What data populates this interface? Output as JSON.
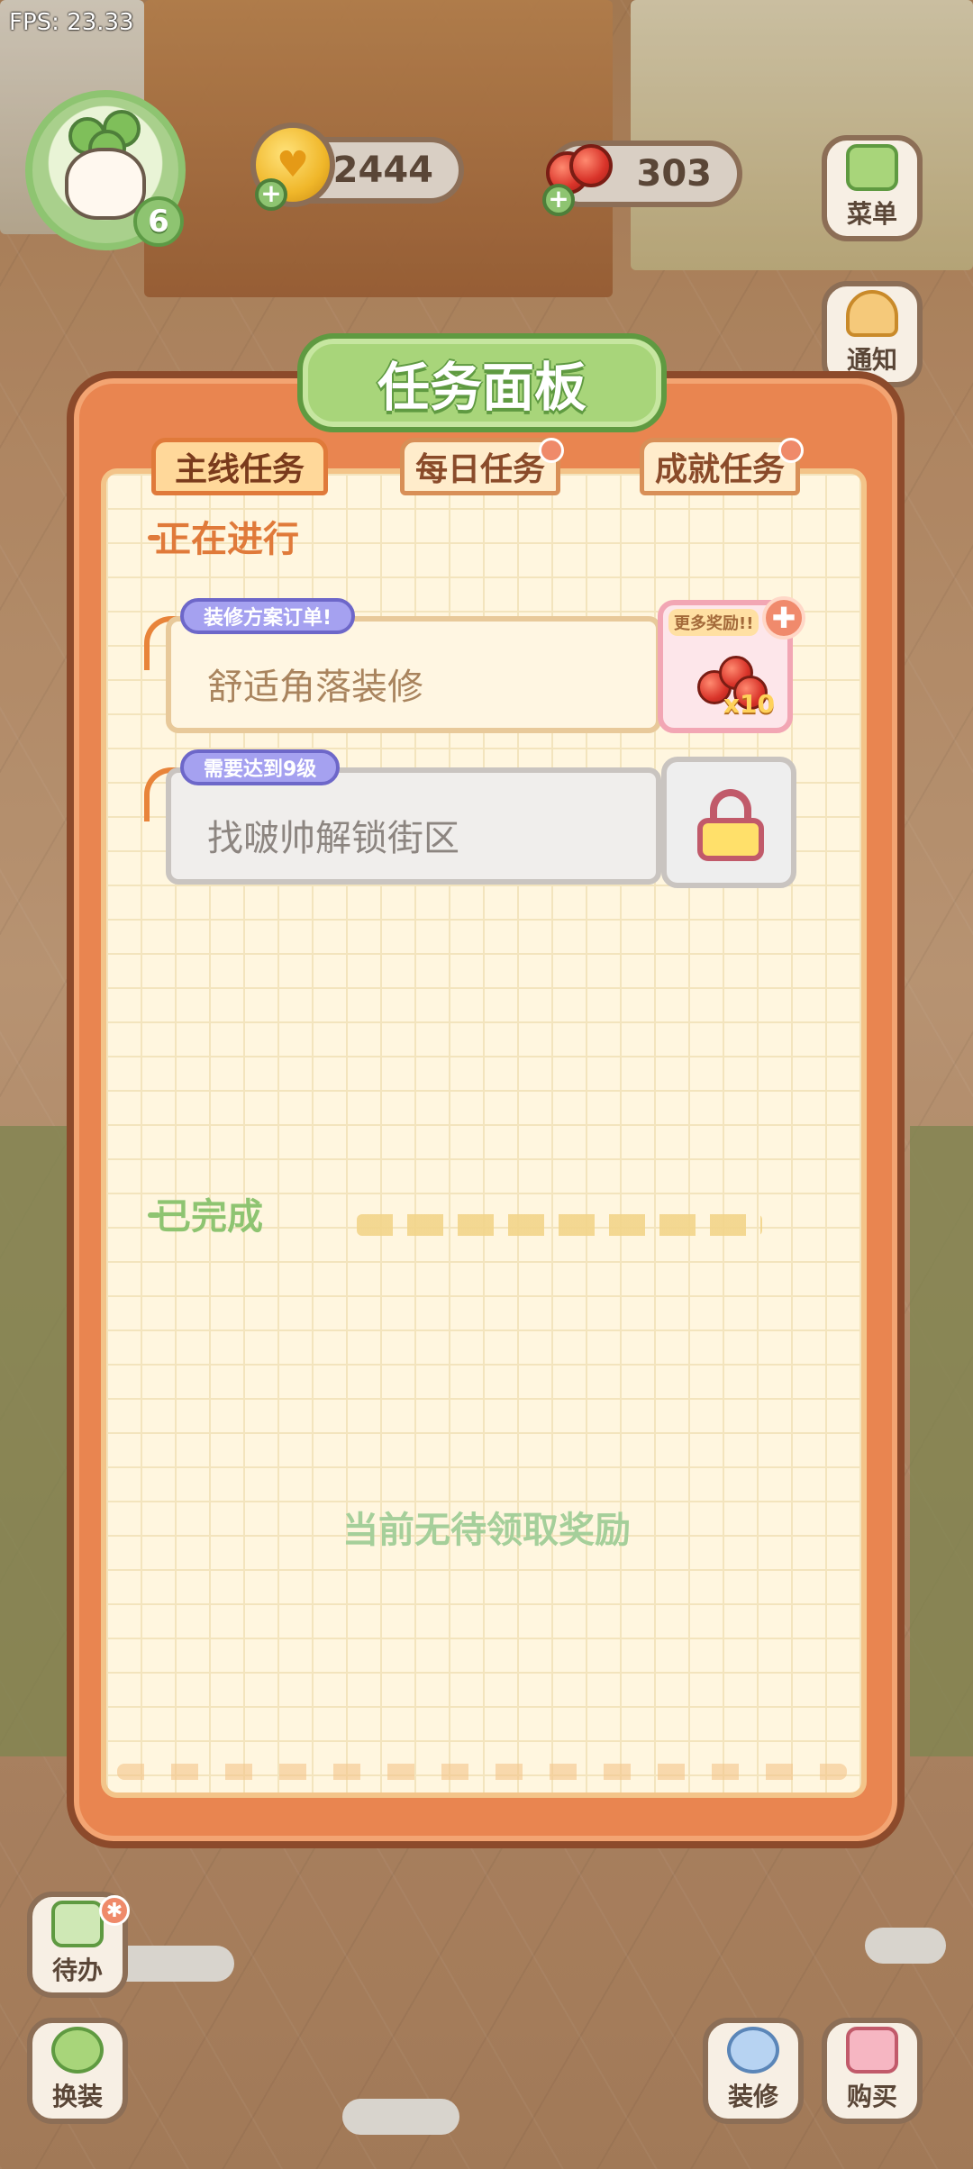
{
  "hud": {
    "fps": "FPS: 23.33",
    "level": "6",
    "coins": "2444",
    "cherries": "303",
    "plus": "+"
  },
  "side_buttons": {
    "menu": "菜单",
    "notice": "通知",
    "todo": "待办",
    "dress": "换装",
    "decor": "装修",
    "buy": "购买"
  },
  "panel": {
    "title": "任务面板",
    "tabs": [
      {
        "label": "主线任务",
        "active": true
      },
      {
        "label": "每日任务",
        "active": false
      },
      {
        "label": "成就任务",
        "active": false
      }
    ],
    "section_ongoing": "正在进行",
    "section_done": "已完成",
    "tasks": [
      {
        "tag": "装修方案订单!",
        "name": "舒适角落装修",
        "reward_more": "更多奖励!!",
        "reward_qty": "x10",
        "locked": false
      },
      {
        "tag": "需要达到9级",
        "name": "找啵帅解锁街区",
        "locked": true
      }
    ],
    "empty_note": "当前无待领取奖励"
  },
  "colors": {
    "panel_orange": "#e98550",
    "paper": "#fff6df",
    "title_green": "#a8d57a",
    "ongoing_label": "#e07a3a",
    "done_label": "#8ec471",
    "tag_purple": "#a5a1f0"
  }
}
